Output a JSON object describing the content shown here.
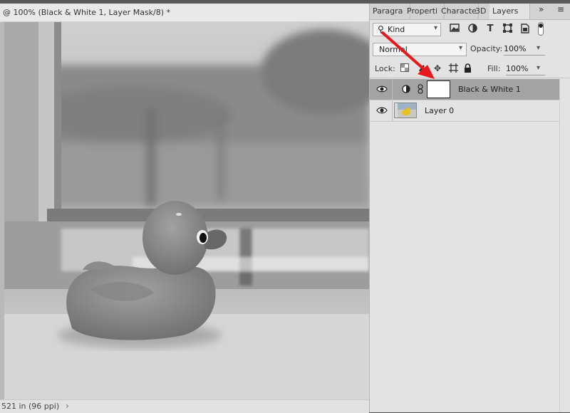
{
  "document": {
    "tab_title": "@ 100% (Black & White 1, Layer Mask/8) *",
    "status_text": "521 in (96 ppi)",
    "status_arrow": "›"
  },
  "panel": {
    "tabs": [
      {
        "label": "Paragra",
        "active": false
      },
      {
        "label": "Properti",
        "active": false
      },
      {
        "label": "Characte",
        "active": false
      },
      {
        "label": "3D",
        "active": false
      },
      {
        "label": "Layers",
        "active": true
      }
    ],
    "overflow_icon": "double-chevron-right-icon",
    "menu_icon": "hamburger-icon",
    "filter": {
      "kind_label": "Kind",
      "icons": [
        "image-filter-icon",
        "adjustment-filter-icon",
        "type-filter-icon",
        "shape-filter-icon",
        "smart-object-filter-icon"
      ]
    },
    "blend_mode": "Normal",
    "opacity_label": "Opacity:",
    "opacity_value": "100%",
    "lock_label": "Lock:",
    "lock_icons": [
      "lock-transparent-icon",
      "lock-image-icon",
      "lock-position-icon",
      "lock-artboard-icon",
      "lock-all-icon"
    ],
    "fill_label": "Fill:",
    "fill_value": "100%",
    "layers": [
      {
        "name": "Black & White 1",
        "selected": true,
        "visible": true,
        "type": "adjustment"
      },
      {
        "name": "Layer 0",
        "selected": false,
        "visible": true,
        "type": "pixel"
      }
    ]
  },
  "colors": {
    "annotation_arrow": "#e8171b",
    "selected_layer": "#a3a3a3",
    "panel_bg": "#e3e3e3"
  }
}
